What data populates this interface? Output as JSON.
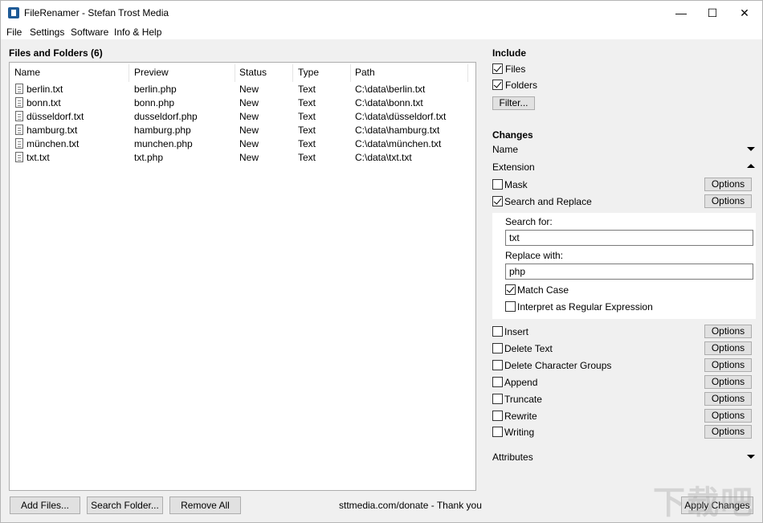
{
  "window": {
    "title": "FileRenamer - Stefan Trost Media",
    "minimize": "—",
    "maximize": "☐",
    "close": "✕"
  },
  "menu": [
    "File",
    "Settings",
    "Software",
    "Info & Help"
  ],
  "files": {
    "title": "Files and Folders (6)",
    "columns": [
      "Name",
      "Preview",
      "Status",
      "Type",
      "Path"
    ],
    "rows": [
      [
        "berlin.txt",
        "berlin.php",
        "New",
        "Text",
        "C:\\data\\berlin.txt"
      ],
      [
        "bonn.txt",
        "bonn.php",
        "New",
        "Text",
        "C:\\data\\bonn.txt"
      ],
      [
        "düsseldorf.txt",
        "dusseldorf.php",
        "New",
        "Text",
        "C:\\data\\düsseldorf.txt"
      ],
      [
        "hamburg.txt",
        "hamburg.php",
        "New",
        "Text",
        "C:\\data\\hamburg.txt"
      ],
      [
        "münchen.txt",
        "munchen.php",
        "New",
        "Text",
        "C:\\data\\münchen.txt"
      ],
      [
        "txt.txt",
        "txt.php",
        "New",
        "Text",
        "C:\\data\\txt.txt"
      ]
    ]
  },
  "bottom": {
    "add_files": "Add Files...",
    "search_folder": "Search Folder...",
    "remove_all": "Remove All",
    "donate": "sttmedia.com/donate - Thank you",
    "apply": "Apply Changes"
  },
  "include": {
    "title": "Include",
    "files": "Files",
    "folders": "Folders",
    "filter": "Filter..."
  },
  "changes": {
    "title": "Changes",
    "name": "Name",
    "extension": "Extension",
    "mask": "Mask",
    "search_replace": "Search and Replace",
    "options": "Options",
    "search_for_label": "Search for:",
    "search_for_value": "txt",
    "replace_with_label": "Replace with:",
    "replace_with_value": "php",
    "match_case": "Match Case",
    "regex": "Interpret as Regular Expression",
    "insert": "Insert",
    "delete_text": "Delete Text",
    "delete_char_groups": "Delete Character Groups",
    "append": "Append",
    "truncate": "Truncate",
    "rewrite": "Rewrite",
    "writing": "Writing",
    "attributes": "Attributes"
  },
  "watermark": "下载吧"
}
